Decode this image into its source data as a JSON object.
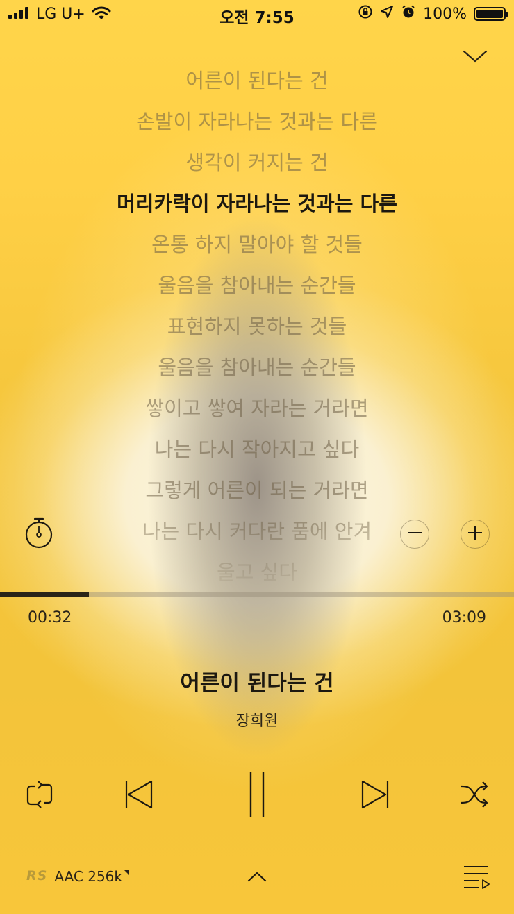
{
  "status_bar": {
    "carrier": "LG U+",
    "time": "오전 7:55",
    "battery": "100%"
  },
  "lyrics": [
    {
      "text": "어른이 된다는 건",
      "active": false
    },
    {
      "text": "손발이 자라나는 것과는 다른",
      "active": false
    },
    {
      "text": "생각이 커지는 건",
      "active": false
    },
    {
      "text": "머리카락이 자라나는 것과는 다른",
      "active": true
    },
    {
      "text": "온통 하지 말아야 할 것들",
      "active": false
    },
    {
      "text": "울음을 참아내는 순간들",
      "active": false
    },
    {
      "text": "표현하지 못하는 것들",
      "active": false
    },
    {
      "text": "울음을 참아내는 순간들",
      "active": false
    },
    {
      "text": "쌓이고 쌓여 자라는 거라면",
      "active": false
    },
    {
      "text": "나는 다시 작아지고 싶다",
      "active": false
    },
    {
      "text": "그렇게 어른이 되는 거라면",
      "active": false
    },
    {
      "text": "나는 다시 커다란 품에 안겨",
      "active": false
    },
    {
      "text": "울고 싶다",
      "active": false
    }
  ],
  "player": {
    "elapsed": "00:32",
    "duration": "03:09",
    "progress": 0.173,
    "title": "어른이 된다는 건",
    "artist": "장희원"
  },
  "quality": {
    "logo": "RS",
    "label": "AAC 256k"
  },
  "icons": {
    "collapse": "chevron-down-icon",
    "timer": "stopwatch-icon",
    "font_smaller": "minus-icon",
    "font_larger": "plus-icon",
    "repeat": "repeat-icon",
    "previous": "skip-previous-icon",
    "pause": "pause-icon",
    "next": "skip-next-icon",
    "shuffle": "shuffle-icon",
    "expand": "chevron-up-icon",
    "playlist": "playlist-icon"
  },
  "colors": {
    "accent": "#f7c93a",
    "text_active": "#1c1810",
    "text_inactive": "#8a7a5a"
  }
}
